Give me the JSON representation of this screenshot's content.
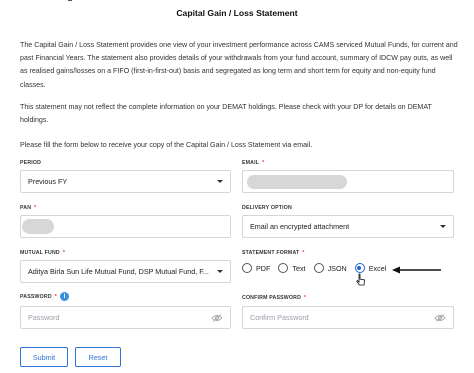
{
  "title": "Capital Gain / Loss Statement",
  "intro_paragraph": "The Capital Gain / Loss Statement provides one view of your investment performance across CAMS serviced Mutual Funds, for current and past Financial Years. The statement also provides details of your withdrawals from your fund account, summary of IDCW pay outs, as well as realised gains/losses on a FIFO (first-in-first-out) basis and segregated as long term and short term for equity and non-equity fund classes.",
  "demat_paragraph": "This statement may not reflect the complete information on your DEMAT holdings. Please check with your DP for details on DEMAT holdings.",
  "instruction": "Please fill the form below to receive your copy of the Capital Gain / Loss Statement via email.",
  "form": {
    "period": {
      "label": "PERIOD",
      "value": "Previous FY"
    },
    "email": {
      "label": "EMAIL",
      "required_mark": "*"
    },
    "pan": {
      "label": "PAN",
      "required_mark": "*"
    },
    "delivery_option": {
      "label": "DELIVERY OPTION",
      "value": "Email an encrypted attachment"
    },
    "mutual_fund": {
      "label": "MUTUAL FUND",
      "required_mark": "*",
      "value": "Aditya Birla Sun Life Mutual Fund, DSP Mutual Fund, F..."
    },
    "statement_format": {
      "label": "STATEMENT FORMAT",
      "required_mark": "*",
      "options": [
        "PDF",
        "Text",
        "JSON",
        "Excel"
      ],
      "selected": "Excel"
    },
    "password": {
      "label": "PASSWORD",
      "required_mark": "*",
      "placeholder": "Password",
      "info_icon": "i"
    },
    "confirm_password": {
      "label": "CONFIRM PASSWORD",
      "required_mark": "*",
      "placeholder": "Confirm Password"
    }
  },
  "buttons": {
    "submit": "Submit",
    "reset": "Reset"
  },
  "icons": {
    "dropdown": "chevron-down-icon",
    "password_toggle": "eye-off-icon",
    "info": "info-icon",
    "annotation": "arrow-left-icon",
    "pointer": "cursor-icon"
  },
  "colors": {
    "accent": "#2f74d8",
    "required": "#e53935",
    "info": "#3b8fe0",
    "border": "#d3d6dc"
  }
}
